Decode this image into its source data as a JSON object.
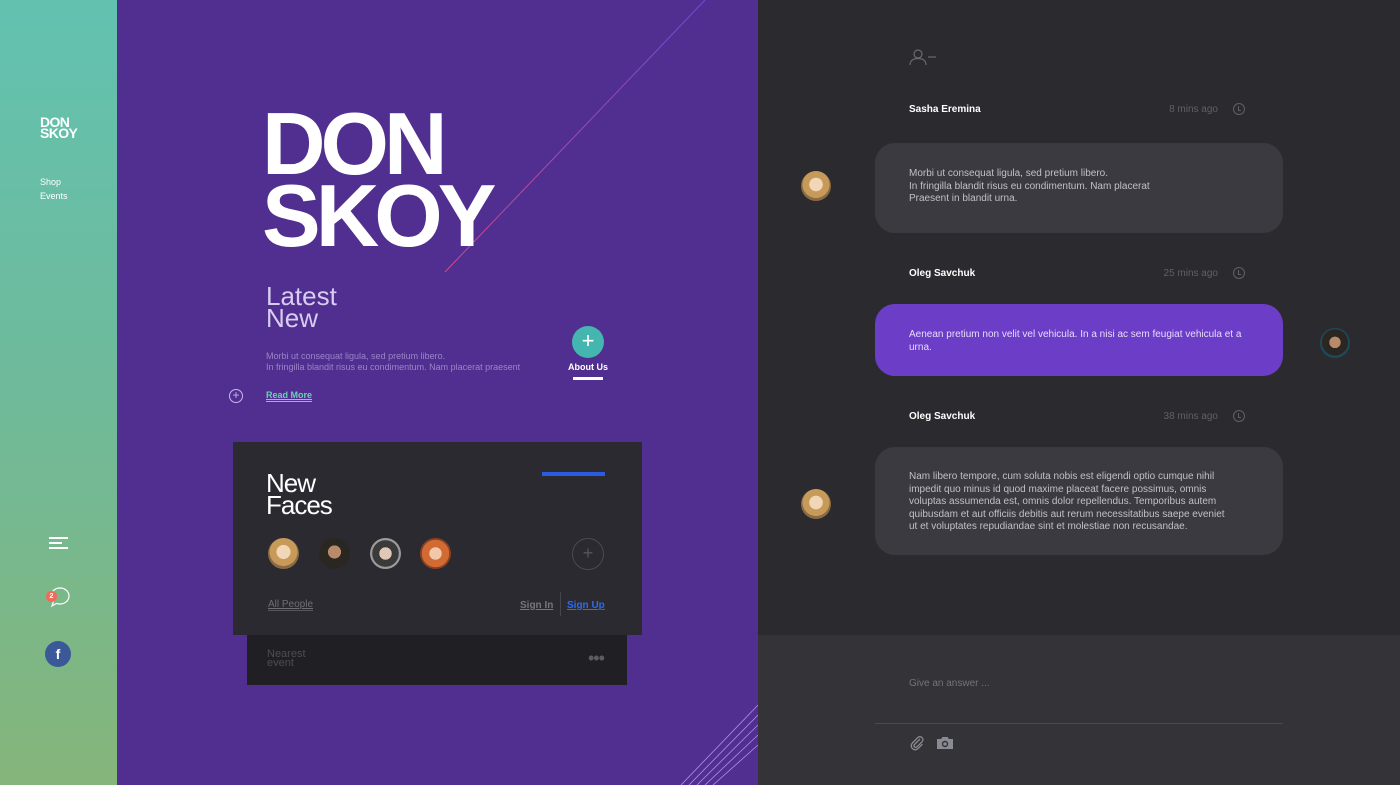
{
  "brand": {
    "logo_line1": "DON",
    "logo_line2": "SKOY"
  },
  "sidebar": {
    "nav": [
      {
        "label": "Shop"
      },
      {
        "label": "Events"
      }
    ],
    "chat_badge": "2",
    "facebook_icon": "facebook-icon"
  },
  "hero": {
    "title_line1": "DON",
    "title_line2": "SKOY",
    "section_line1": "Latest",
    "section_line2": "New",
    "desc_line1": "Morbi ut consequat ligula, sed pretium libero.",
    "desc_line2": "In fringilla blandit risus eu condimentum. Nam placerat praesent",
    "read_more": "Read More",
    "about_us": "About Us",
    "about_icon": "+",
    "bg_color": "#502f90"
  },
  "faces": {
    "title_line1": "New",
    "title_line2": "Faces",
    "add_icon": "+",
    "all_people": "All People",
    "sign_in": "Sign In",
    "sign_up": "Sign Up"
  },
  "event": {
    "label_line1": "Nearest",
    "label_line2": "event",
    "more_icon": "•••"
  },
  "chat": {
    "messages": [
      {
        "name": "Sasha Eremina",
        "time": "8 mins ago",
        "lines": [
          "Morbi ut consequat ligula, sed pretium libero.",
          "In fringilla blandit risus eu condimentum. Nam placerat",
          "Praesent in blandit urna."
        ]
      },
      {
        "name": "Oleg Savchuk",
        "time": "25 mins ago",
        "lines": [
          "Aenean pretium non velit vel vehicula. In a nisi ac sem feugiat vehicula et a",
          "urna."
        ]
      },
      {
        "name": "Oleg Savchuk",
        "time": "38 mins ago",
        "lines": [
          "Nam libero tempore, cum soluta nobis est eligendi optio cumque nihil",
          "impedit quo minus id quod maxime placeat facere possimus, omnis",
          "voluptas assumenda est, omnis dolor repellendus. Temporibus autem",
          "quibusdam et aut officiis debitis aut rerum necessitatibus saepe eveniet",
          "ut et voluptates repudiandae sint et molestiae non recusandae."
        ]
      }
    ],
    "answer_placeholder": "Give an answer ...",
    "accent_color": "#6c3ec8"
  }
}
